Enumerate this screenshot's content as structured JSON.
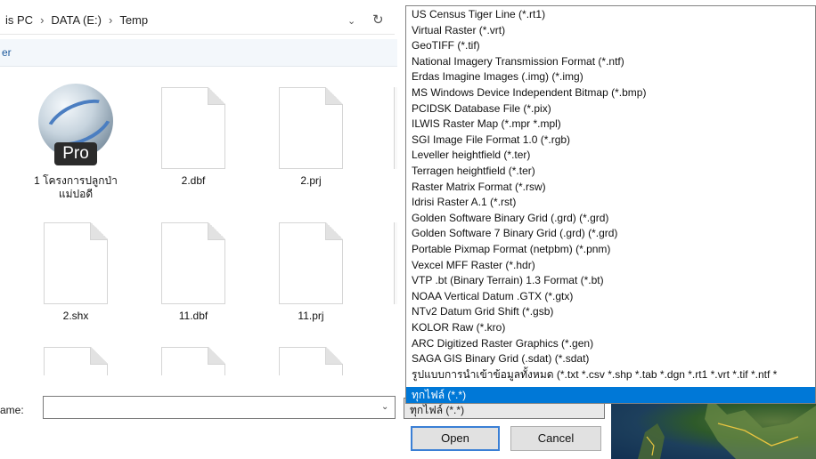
{
  "address": {
    "crumbs": [
      "is PC",
      "DATA (E:)",
      "Temp"
    ],
    "separator": "›",
    "dropdown_icon": "chevron-down-icon",
    "refresh_icon": "refresh-icon"
  },
  "toolbar": {
    "label": "er"
  },
  "files": [
    {
      "name": "1 โครงการปลูกป่า",
      "name2": "แม่ปอดี",
      "icon": "google-earth-pro-icon",
      "badge": "Pro"
    },
    {
      "name": "2.dbf",
      "icon": "document-icon"
    },
    {
      "name": "2.prj",
      "icon": "document-icon"
    },
    {
      "name": "",
      "icon": "document-icon"
    },
    {
      "name": "2.shx",
      "icon": "document-icon"
    },
    {
      "name": "11.dbf",
      "icon": "document-icon"
    },
    {
      "name": "11.prj",
      "icon": "document-icon"
    },
    {
      "name": "",
      "icon": "document-icon"
    },
    {
      "name": "",
      "icon": "document-icon"
    },
    {
      "name": "",
      "icon": "document-icon"
    },
    {
      "name": "",
      "icon": "document-icon"
    }
  ],
  "filename": {
    "label": "ame:",
    "value": ""
  },
  "filetype": {
    "selected": "ทุกไฟล์ (*.*)",
    "options": [
      "US Census Tiger Line (*.rt1)",
      "Virtual Raster (*.vrt)",
      "GeoTIFF (*.tif)",
      "National Imagery Transmission Format (*.ntf)",
      "Erdas Imagine Images (.img) (*.img)",
      "MS Windows Device Independent Bitmap (*.bmp)",
      "PCIDSK Database File (*.pix)",
      "ILWIS Raster Map (*.mpr *.mpl)",
      "SGI Image File Format 1.0 (*.rgb)",
      "Leveller heightfield (*.ter)",
      "Terragen heightfield (*.ter)",
      "Raster Matrix Format (*.rsw)",
      "Idrisi Raster A.1 (*.rst)",
      "Golden Software Binary Grid (.grd) (*.grd)",
      "Golden Software 7 Binary Grid (.grd) (*.grd)",
      "Portable Pixmap Format (netpbm) (*.pnm)",
      "Vexcel MFF Raster (*.hdr)",
      "VTP .bt (Binary Terrain) 1.3 Format (*.bt)",
      "NOAA Vertical Datum .GTX (*.gtx)",
      "NTv2 Datum Grid Shift (*.gsb)",
      "KOLOR Raw (*.kro)",
      "ARC Digitized Raster Graphics (*.gen)",
      "SAGA GIS Binary Grid (.sdat) (*.sdat)",
      "รูปแบบการนำเข้าข้อมูลทั้งหมด (*.txt *.csv *.shp *.tab *.dgn *.rt1 *.vrt *.tif *.ntf *"
    ],
    "highlighted": "ทุกไฟล์ (*.*)",
    "highlight_color": "#0078d7"
  },
  "buttons": {
    "open": "Open",
    "cancel": "Cancel"
  }
}
